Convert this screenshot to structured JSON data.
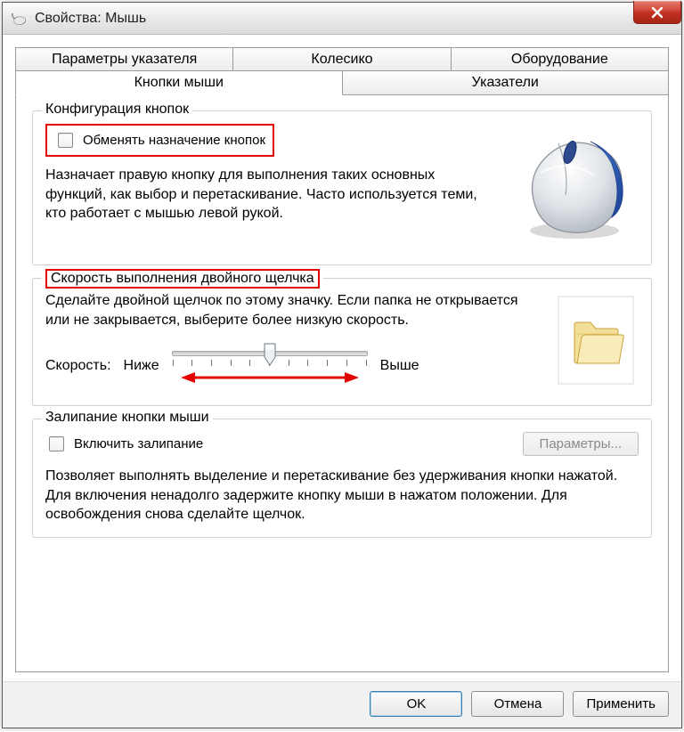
{
  "window": {
    "title": "Свойства: Мышь"
  },
  "tabs": {
    "row1": [
      {
        "label": "Параметры указателя"
      },
      {
        "label": "Колесико"
      },
      {
        "label": "Оборудование"
      }
    ],
    "row2": [
      {
        "label": "Кнопки мыши",
        "active": true
      },
      {
        "label": "Указатели"
      }
    ]
  },
  "group_buttons": {
    "title": "Конфигурация кнопок",
    "checkbox_label": "Обменять назначение кнопок",
    "description": "Назначает правую кнопку для выполнения таких основных функций, как выбор и перетаскивание. Часто используется теми, кто работает с мышью левой рукой."
  },
  "group_dblclick": {
    "title": "Скорость выполнения двойного щелчка",
    "description": "Сделайте двойной щелчок по этому значку. Если папка не открывается или не закрывается, выберите более низкую скорость.",
    "speed_label": "Скорость:",
    "slow_label": "Ниже",
    "fast_label": "Выше"
  },
  "group_clicklock": {
    "title": "Залипание кнопки мыши",
    "checkbox_label": "Включить залипание",
    "params_button": "Параметры...",
    "description": "Позволяет выполнять выделение и перетаскивание без удерживания кнопки нажатой. Для включения ненадолго задержите кнопку мыши в нажатом положении. Для освобождения снова сделайте щелчок."
  },
  "footer": {
    "ok": "OK",
    "cancel": "Отмена",
    "apply": "Применить"
  }
}
